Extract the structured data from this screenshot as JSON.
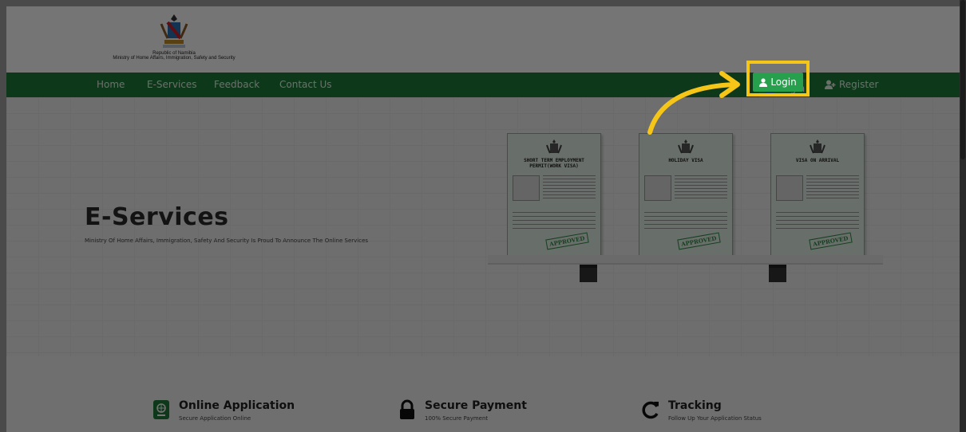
{
  "header": {
    "country": "Republic of Namibia",
    "ministry": "Ministry of Home Affairs, Immigration, Safety and Security"
  },
  "nav": {
    "items": [
      "Home",
      "E-Services",
      "Feedback",
      "Contact Us"
    ],
    "login": "Login",
    "register": "Register"
  },
  "hero": {
    "title": "E-Services",
    "subtitle": "Ministry Of Home Affairs, Immigration, Safety And Security Is Proud To Announce The Online Services"
  },
  "documents": [
    {
      "title": "SHORT TERM EMPLOYMENT PERMIT(WORK VISA)",
      "stamp": "APPROVED"
    },
    {
      "title": "HOLIDAY VISA",
      "stamp": "APPROVED"
    },
    {
      "title": "VISA ON ARRIVAL",
      "stamp": "APPROVED"
    }
  ],
  "features": [
    {
      "title": "Online Application",
      "desc": "Secure Application Online",
      "icon": "passport-icon"
    },
    {
      "title": "Secure Payment",
      "desc": "100% Secure Payment",
      "icon": "lock-icon"
    },
    {
      "title": "Tracking",
      "desc": "Follow Up Your Application Status",
      "icon": "refresh-icon"
    }
  ],
  "colors": {
    "nav_green": "#1f7a3a",
    "login_green": "#27a04e",
    "highlight_yellow": "#f5c518"
  }
}
